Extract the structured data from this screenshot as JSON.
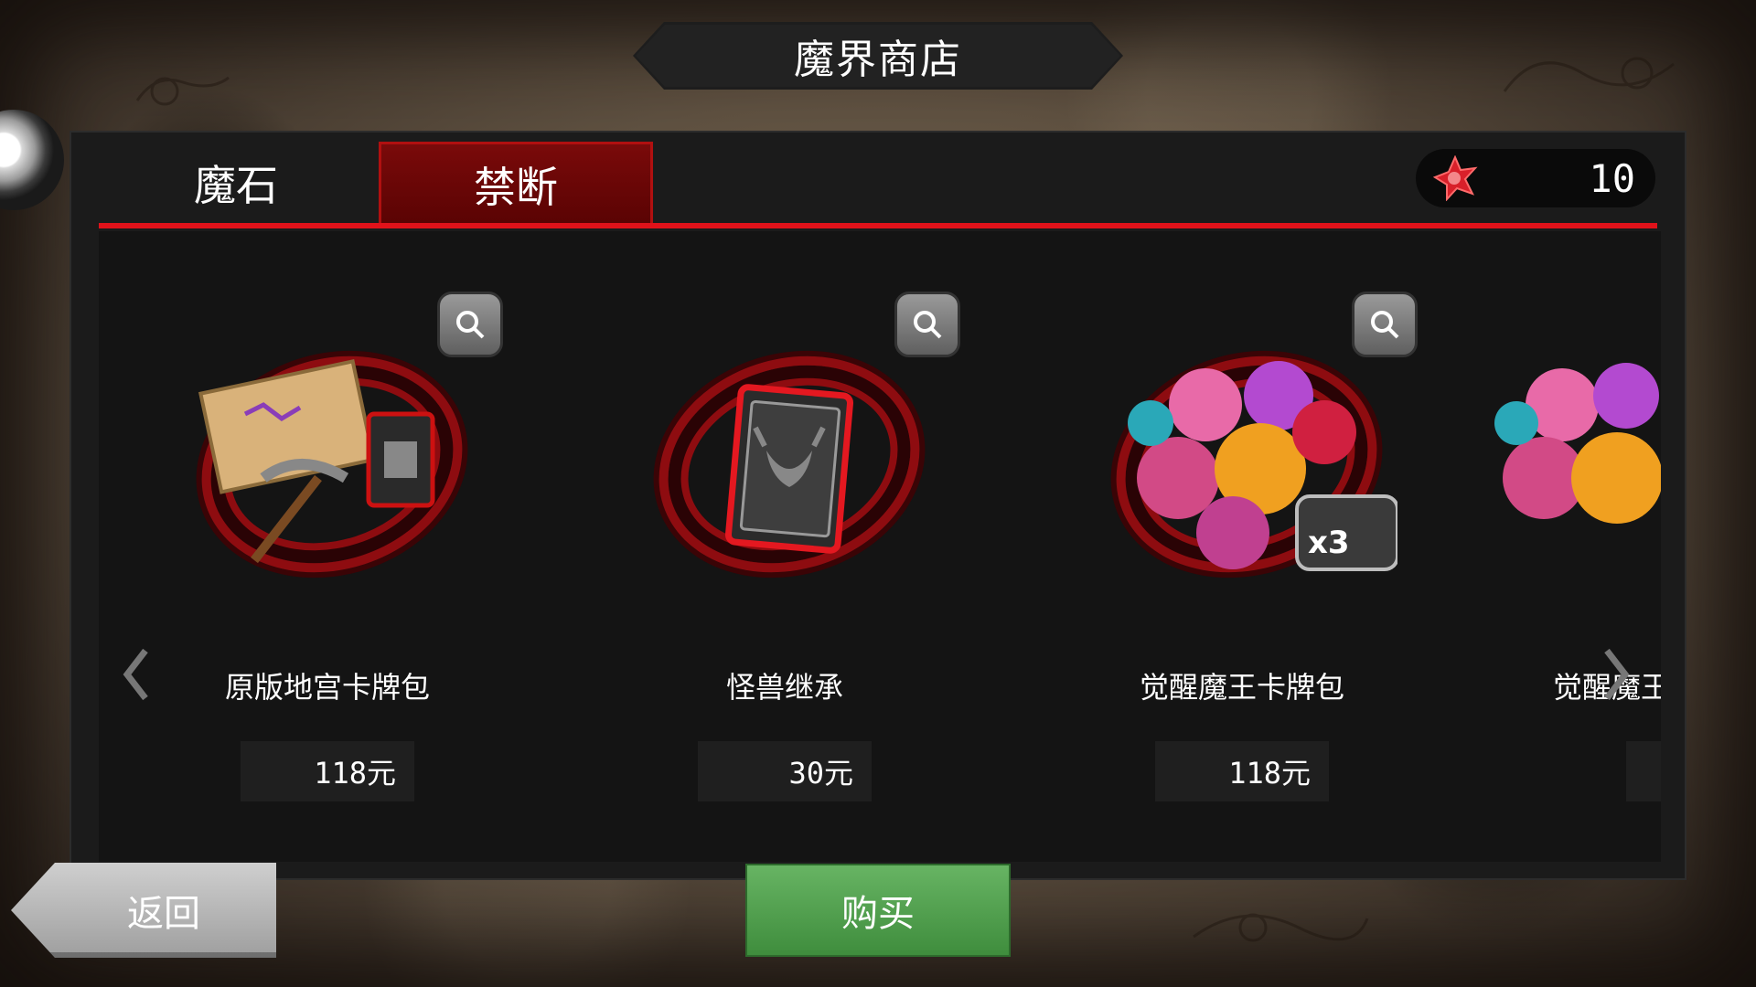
{
  "header": {
    "title": "魔界商店"
  },
  "tabs": [
    {
      "label": "魔石",
      "active": false
    },
    {
      "label": "禁断",
      "active": true
    }
  ],
  "currency": {
    "icon": "red-gem-icon",
    "value": "10"
  },
  "products": [
    {
      "name": "原版地宫卡牌包",
      "price": "118元",
      "art": "scroll-pickaxe-card-art"
    },
    {
      "name": "怪兽继承",
      "price": "30元",
      "art": "demon-card-art"
    },
    {
      "name": "觉醒魔王卡牌包",
      "price": "118元",
      "art": "demon-lords-x3-art",
      "badge": "x3"
    },
    {
      "name": "觉醒魔王",
      "price": "",
      "art": "demon-lords-art"
    }
  ],
  "nav": {
    "left_icon": "chevron-left-icon",
    "right_icon": "chevron-right-icon"
  },
  "footer": {
    "back_label": "返回",
    "buy_label": "购买"
  },
  "colors": {
    "accent_red": "#e0121a",
    "tab_active": "#6b0606",
    "buy_green": "#52a14f"
  }
}
